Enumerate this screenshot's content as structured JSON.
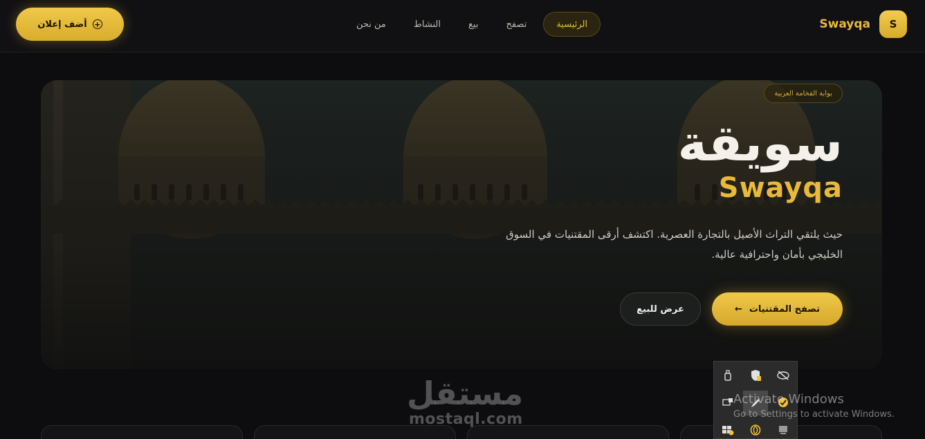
{
  "navbar": {
    "add_ad_label": "أضف إعلان",
    "links": [
      {
        "label": "الرئيسية",
        "active": true
      },
      {
        "label": "تصفح",
        "active": false
      },
      {
        "label": "بيع",
        "active": false
      },
      {
        "label": "النشاط",
        "active": false
      },
      {
        "label": "من نحن",
        "active": false
      }
    ],
    "brand_name": "Swayqa",
    "brand_logo_letter": "S"
  },
  "hero": {
    "badge": "بوابة الفخامة العربية",
    "title_ar": "سويقة",
    "title_en": "Swayqa",
    "description": "حيث يلتقي التراث الأصيل بالتجارة العصرية. اكتشف أرقى المقتنيات في السوق الخليجي بأمان واحترافية عالية.",
    "browse_button": "تصفح المقتنيات",
    "browse_arrow": "←",
    "sell_button": "عرض للبيع"
  },
  "watermark": {
    "text_ar": "مستقل",
    "text_en": "mostaql.com"
  },
  "tray": {
    "icons": [
      "usb-drive-icon",
      "windows-security-icon",
      "hidden-eye-icon",
      "network-device-icon",
      "pen-icon",
      "norton-icon",
      "windows-update-icon",
      "opera-icon",
      "display-icon"
    ]
  },
  "activation": {
    "title": "Activate Windows",
    "subtitle": "Go to Settings to activate Windows."
  },
  "colors": {
    "accent_gold": "#e8b93a",
    "background": "#0d0d0f",
    "navbar": "#111113"
  }
}
